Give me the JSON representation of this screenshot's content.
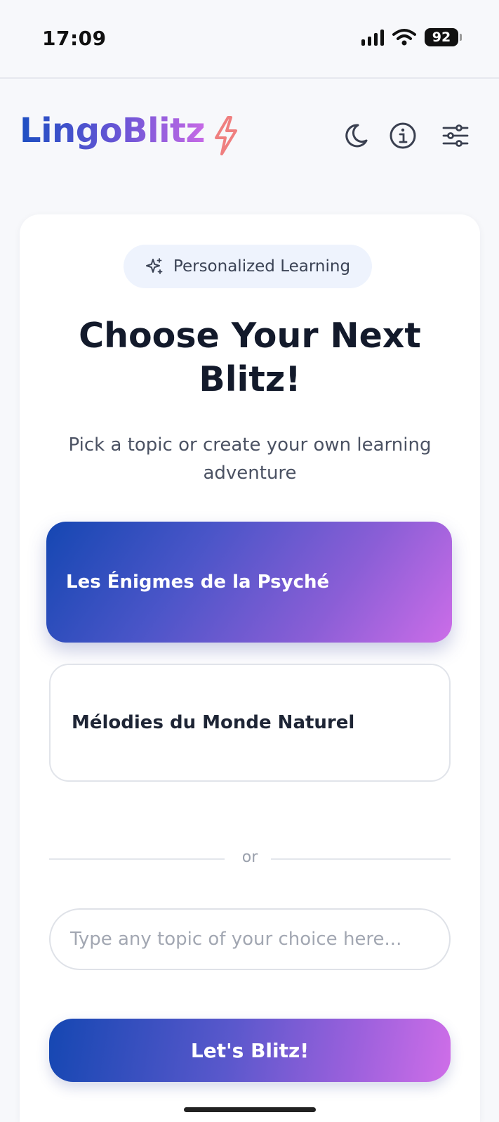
{
  "status_bar": {
    "time": "17:09",
    "battery": "92"
  },
  "header": {
    "logo": "LingoBlitz",
    "icons": [
      "moon-icon",
      "info-icon",
      "sliders-icon"
    ]
  },
  "card": {
    "badge": "Personalized Learning",
    "title": "Choose Your Next Blitz!",
    "subtitle": "Pick a topic or create your own learning adventure",
    "topics": [
      {
        "label": "Les Énigmes de la Psyché",
        "selected": true
      },
      {
        "label": "Mélodies du Monde Naturel",
        "selected": false
      }
    ],
    "divider_text": "or",
    "custom_topic": {
      "placeholder": "Type any topic of your choice here...",
      "value": ""
    },
    "submit_label": "Let's Blitz!"
  },
  "colors": {
    "accent_start": "#1547b2",
    "accent_end": "#cc6de8",
    "bolt": "#ef7f7f",
    "background": "#f7f8fb"
  }
}
